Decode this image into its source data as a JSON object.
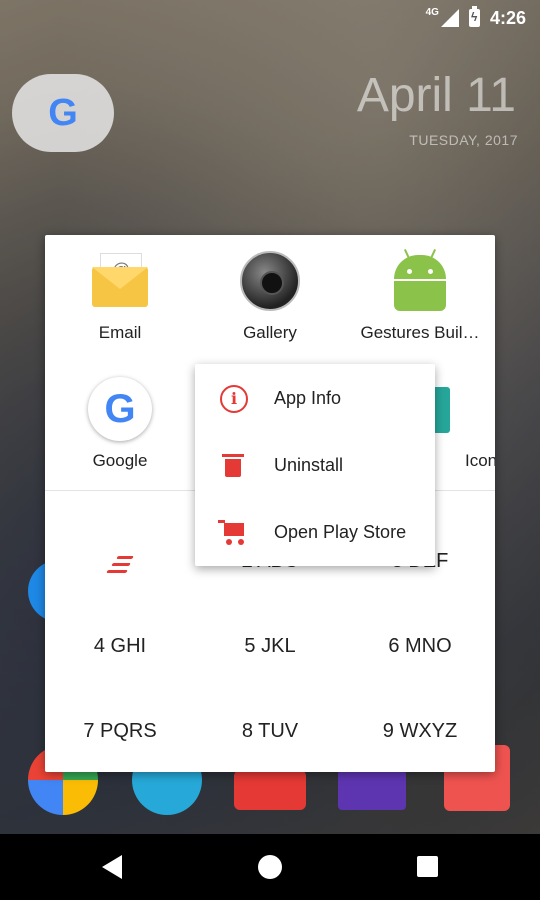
{
  "status": {
    "network": "4G",
    "time": "4:26"
  },
  "date_widget": {
    "date": "April 11",
    "weekday_year": "TUESDAY, 2017"
  },
  "search": {
    "logo": "G"
  },
  "apps": [
    {
      "label": "Email",
      "icon": "email-icon"
    },
    {
      "label": "Gallery",
      "icon": "gallery-icon"
    },
    {
      "label": "Gestures Buil…",
      "icon": "android-icon"
    },
    {
      "label": "Google",
      "icon": "google-icon"
    },
    {
      "label": "Icon …",
      "icon": "icon-app-icon"
    }
  ],
  "dialpad": [
    "2 ABC",
    "3 DEF",
    "4 GHI",
    "5 JKL",
    "6 MNO",
    "7 PQRS",
    "8 TUV",
    "9 WXYZ"
  ],
  "context_menu": {
    "items": [
      {
        "label": "App Info",
        "icon": "info-icon"
      },
      {
        "label": "Uninstall",
        "icon": "trash-icon"
      },
      {
        "label": "Open Play Store",
        "icon": "cart-icon"
      }
    ]
  },
  "colors": {
    "accent": "#e53935",
    "panel": "#ffffff",
    "navbar": "#000000"
  }
}
